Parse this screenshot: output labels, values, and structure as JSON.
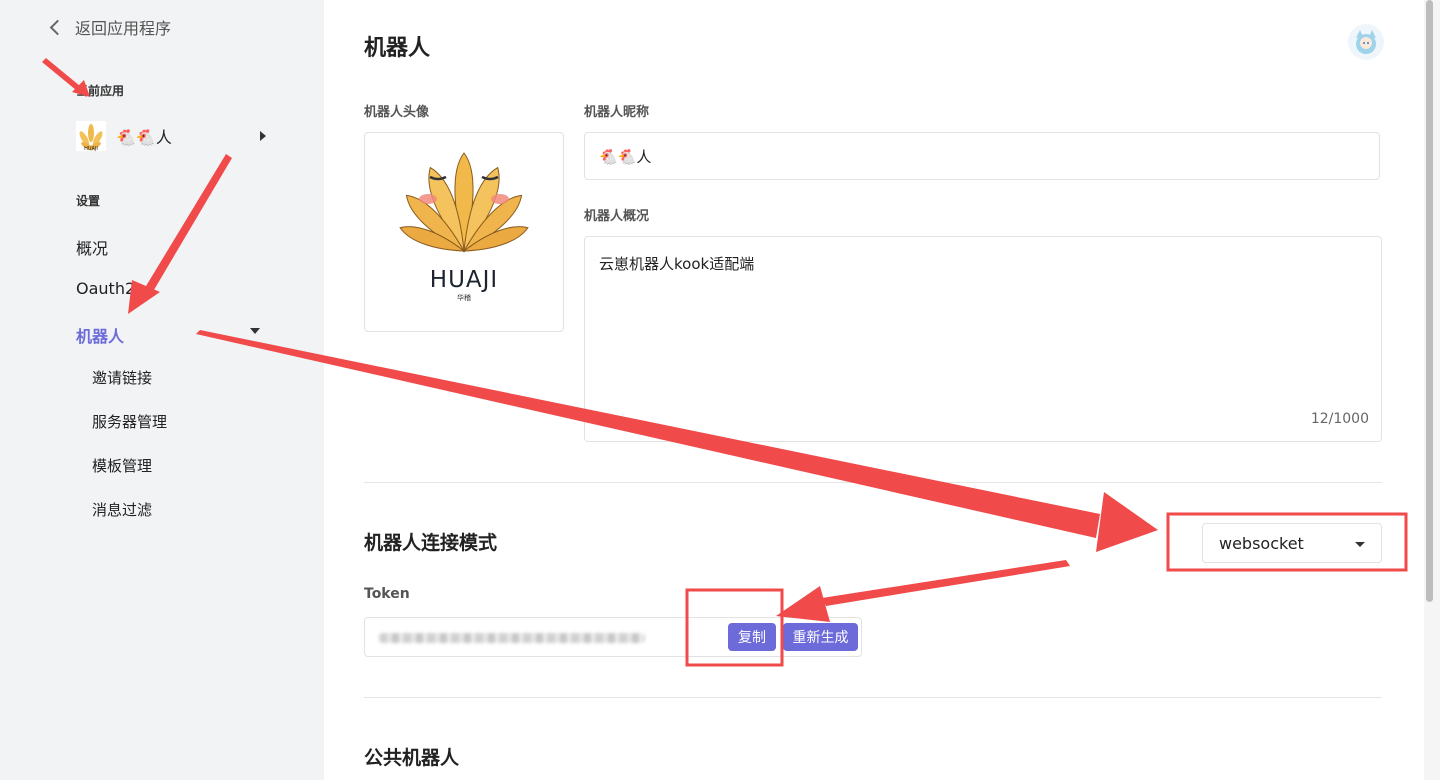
{
  "sidebar": {
    "back_label": "返回应用程序",
    "current_app_label": "当前应用",
    "app_name": "🐔🐔人",
    "settings_label": "设置",
    "nav": {
      "overview": "概况",
      "oauth2": "Oauth2",
      "bot": "机器人",
      "invite": "邀请链接",
      "servers": "服务器管理",
      "templates": "模板管理",
      "filters": "消息过滤"
    }
  },
  "main": {
    "page_title": "机器人",
    "avatar_label": "机器人头像",
    "avatar_logo": {
      "text": "HUAJI",
      "subtext": "华稽"
    },
    "nickname_label": "机器人昵称",
    "nickname_value": "🐔🐔人",
    "summary_label": "机器人概况",
    "summary_value": "云崽机器人kook适配端",
    "summary_counter": "12/1000",
    "connection_title": "机器人连接模式",
    "connection_mode": "websocket",
    "token_label": "Token",
    "copy_button": "复制",
    "regenerate_button": "重新生成",
    "public_bot_title": "公共机器人"
  },
  "colors": {
    "accent": "#6c6bd9",
    "sidebar_bg": "#f2f3f5",
    "annotation_red": "#f04a4a"
  },
  "icons": {
    "back": "chevron-left-icon",
    "app_expand": "triangle-right-icon",
    "bot_collapse": "triangle-down-icon",
    "select_caret": "caret-down-icon"
  }
}
